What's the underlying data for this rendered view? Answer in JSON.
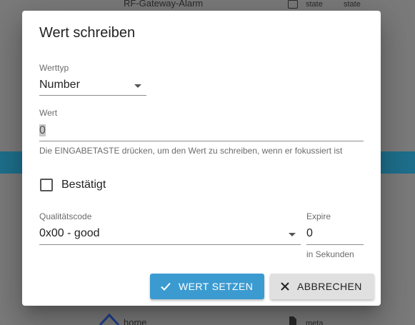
{
  "background": {
    "top_item": "RF-Gateway-Alarm",
    "col1": "state",
    "col2": "state",
    "bottom_item": "home",
    "bottom_meta": "meta"
  },
  "dialog": {
    "title": "Wert schreiben",
    "type_label": "Werttyp",
    "type_value": "Number",
    "value_label": "Wert",
    "value": "0",
    "helper": "Die EINGABETASTE drücken, um den Wert zu schreiben, wenn er fokussiert ist",
    "ack_label": "Bestätigt",
    "quality_label": "Qualitätscode",
    "quality_value": "0x00 - good",
    "expire_label": "Expire",
    "expire_value": "0",
    "expire_helper": "in Sekunden",
    "set_button": "WERT SETZEN",
    "cancel_button": "ABBRECHEN"
  },
  "colors": {
    "primary": "#3b9bd1",
    "secondary": "#e0e0e0",
    "bar": "#1e6f8c"
  }
}
